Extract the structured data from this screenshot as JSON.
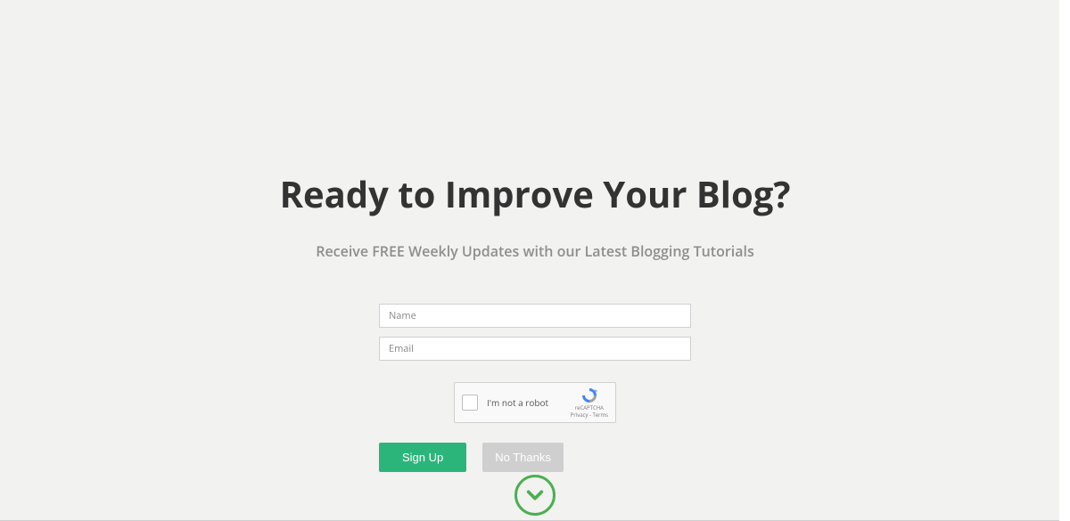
{
  "heading": "Ready to Improve Your Blog?",
  "subheading": "Receive FREE Weekly Updates with our Latest Blogging Tutorials",
  "form": {
    "name_placeholder": "Name",
    "email_placeholder": "Email"
  },
  "recaptcha": {
    "label": "I'm not a robot",
    "brand": "reCAPTCHA",
    "links": "Privacy - Terms"
  },
  "buttons": {
    "signup": "Sign Up",
    "nothanks": "No Thanks"
  },
  "colors": {
    "accent_green": "#2cb57b",
    "scroll_green": "#4caf50",
    "gray_button": "#cfcfcf",
    "background": "#f2f2f1"
  }
}
